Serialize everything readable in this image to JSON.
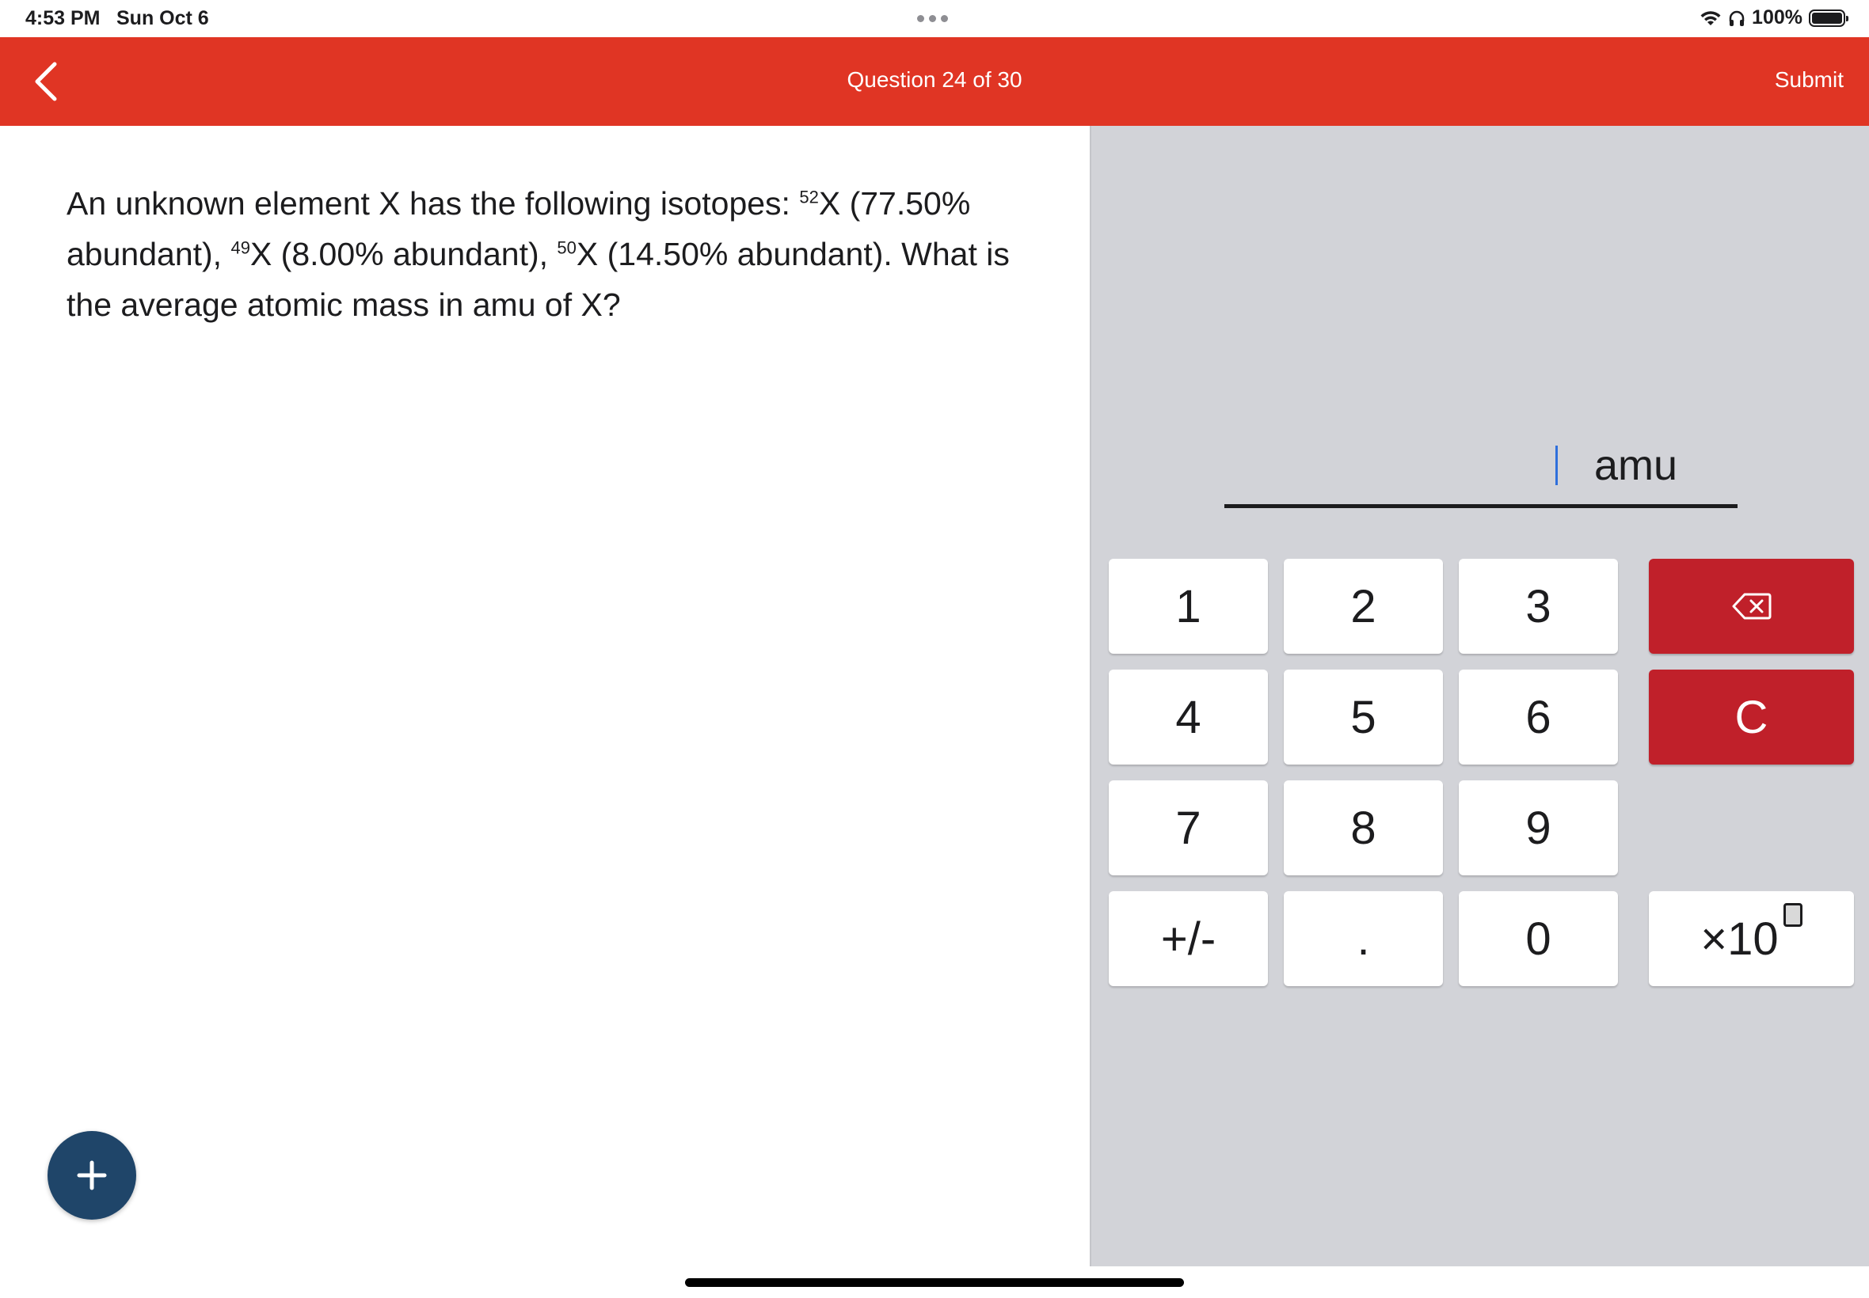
{
  "status_bar": {
    "time": "4:53 PM",
    "date": "Sun Oct 6",
    "battery": "100%",
    "icons": [
      "wifi-icon",
      "headphones-icon",
      "battery-icon"
    ]
  },
  "header": {
    "back_icon": "chevron-left-icon",
    "title": "Question 24 of 30",
    "submit_label": "Submit",
    "color": "#e03524"
  },
  "question": {
    "part1": "An unknown element X has the following isotopes: ",
    "iso1_mass": "52",
    "iso1_text": "X (77.50% abundant), ",
    "iso2_mass": "49",
    "iso2_text": "X (8.00% abundant), ",
    "iso3_mass": "50",
    "iso3_text": "X (14.50% abundant). What is the average atomic mass in amu of X?"
  },
  "answer": {
    "value": "",
    "unit": "amu"
  },
  "keypad": {
    "keys": [
      "1",
      "2",
      "3",
      "4",
      "5",
      "6",
      "7",
      "8",
      "9",
      "+/-",
      ".",
      "0"
    ],
    "clear_label": "C",
    "backspace_icon": "backspace-icon",
    "exponent_label": "×10",
    "accent_red": "#c0202a"
  },
  "fab": {
    "icon": "plus-icon",
    "color": "#1f4569"
  }
}
